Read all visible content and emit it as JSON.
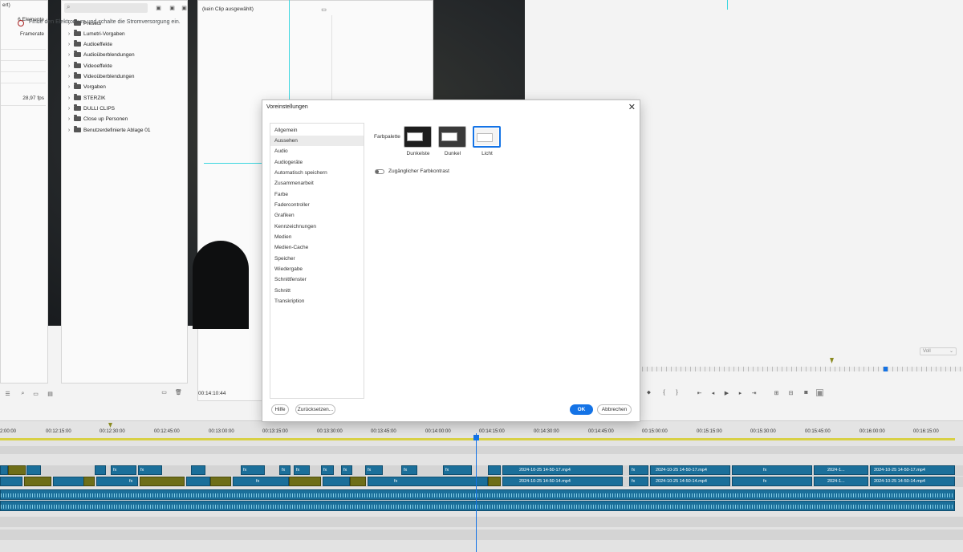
{
  "project_panel": {
    "title_fragment": "ert)",
    "item_count": "6 Elemente",
    "framerate_label": "Framerate",
    "fps_value": "28,97 fps"
  },
  "effects_panel": {
    "items": [
      {
        "label": "Presets"
      },
      {
        "label": "Lumetri-Vorgaben"
      },
      {
        "label": "Audioeffekte"
      },
      {
        "label": "Audioüberblendungen"
      },
      {
        "label": "Videoeffekte"
      },
      {
        "label": "Videoüberblendungen"
      },
      {
        "label": "Vorgaben"
      },
      {
        "label": "STERZIK"
      },
      {
        "label": "DULLI CLIPS"
      },
      {
        "label": "Close up Personen"
      },
      {
        "label": "Benutzerdefinierte Ablage 01"
      }
    ]
  },
  "effect_controls": {
    "no_clip": "(kein Clip ausgewählt)",
    "timecode": "00:14:10:44"
  },
  "program_monitor": {
    "subtitle": "Finde den Elektroraum und schalte die Stromversorgung ein.",
    "resolution": "Voll"
  },
  "dialog": {
    "title": "Voreinstellungen",
    "nav": [
      "Allgemein",
      "Aussehen",
      "Audio",
      "Audiogeräte",
      "Automatisch speichern",
      "Zusammenarbeit",
      "Farbe",
      "Fadercontroller",
      "Grafiken",
      "Kennzeichnungen",
      "Medien",
      "Medien-Cache",
      "Speicher",
      "Wiedergabe",
      "Schnittfenster",
      "Schnitt",
      "Transkription"
    ],
    "selected_nav": "Aussehen",
    "farbpalette_label": "Farbpalette",
    "themes": [
      {
        "label": "Dunkelste"
      },
      {
        "label": "Dunkel"
      },
      {
        "label": "Licht"
      }
    ],
    "selected_theme": "Licht",
    "contrast_label": "Zugänglicher Farbkontrast",
    "contrast_on": false,
    "help_label": "Hilfe",
    "reset_label": "Zurücksetzen...",
    "ok_label": "OK",
    "cancel_label": "Abbrechen"
  },
  "timeline": {
    "ruler": [
      "2:00:00",
      "00:12:15:00",
      "00:12:30:00",
      "00:12:45:00",
      "00:13:00:00",
      "00:13:15:00",
      "00:13:30:00",
      "00:13:45:00",
      "00:14:00:00",
      "00:14:15:00",
      "00:14:30:00",
      "00:14:45:00",
      "00:15:00:00",
      "00:15:15:00",
      "00:15:30:00",
      "00:15:45:00",
      "00:16:00:00",
      "00:16:15:00"
    ],
    "clip_fx": "fx",
    "clip_names": {
      "v2_a": "2024-10-25 14-50-17.mp4",
      "v1_a": "2024-10-25 14-50-14.mp4",
      "v2_b": "2024-10-25 14-50-17.mp4",
      "v1_b": "2024-10-25 14-50-14.mp4",
      "v2_c": "2024-1...",
      "v1_c": "2024-1...",
      "v2_d": "2024-10-25 14-50-17.mp4",
      "v1_d": "2024-10-25 14-50-14.mp4"
    }
  },
  "colors": {
    "accent": "#1473e6",
    "guide": "#3ad6e0",
    "clip_blue": "#1b6f9a",
    "clip_olive": "#6e6e19"
  }
}
